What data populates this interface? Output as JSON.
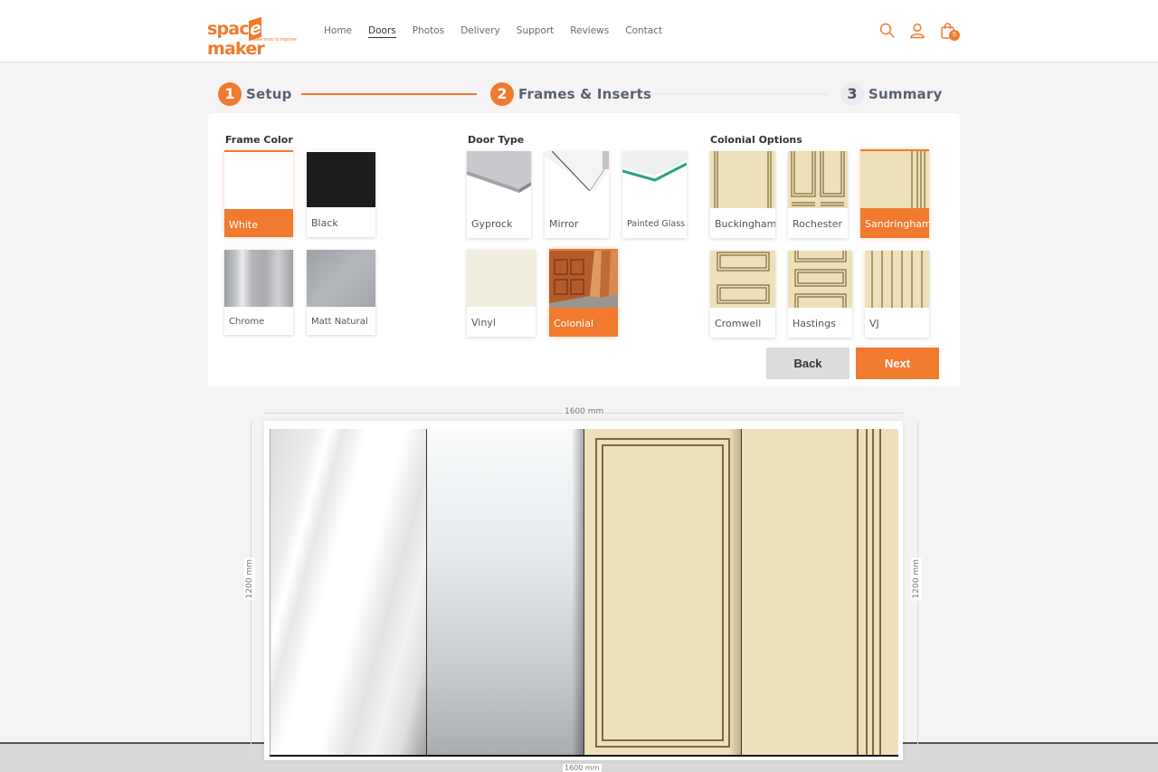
{
  "brand": {
    "name_prefix": "spac",
    "name_e": "e",
    "name_suffix": "maker",
    "tagline": "Make room to improve",
    "accent": "#f07a2e"
  },
  "nav": {
    "items": [
      {
        "label": "Home",
        "active": false
      },
      {
        "label": "Doors",
        "active": true
      },
      {
        "label": "Photos",
        "active": false
      },
      {
        "label": "Delivery",
        "active": false
      },
      {
        "label": "Support",
        "active": false
      },
      {
        "label": "Reviews",
        "active": false
      },
      {
        "label": "Contact",
        "active": false
      }
    ],
    "icons": [
      "search-icon",
      "account-icon",
      "cart-icon"
    ],
    "cart_count": "5"
  },
  "stepper": {
    "steps": [
      {
        "num": "1",
        "label": "Setup",
        "state": "done"
      },
      {
        "num": "2",
        "label": "Frames & Inserts",
        "state": "current"
      },
      {
        "num": "3",
        "label": "Summary",
        "state": "upcoming"
      }
    ]
  },
  "frame_color": {
    "title": "Frame Color",
    "options": [
      {
        "label": "White",
        "selected": true
      },
      {
        "label": "Black",
        "selected": false
      },
      {
        "label": "Chrome",
        "selected": false
      },
      {
        "label": "Matt Natural",
        "selected": false
      }
    ]
  },
  "door_type": {
    "title": "Door Type",
    "options": [
      {
        "label": "Gyprock",
        "selected": false
      },
      {
        "label": "Mirror",
        "selected": false
      },
      {
        "label": "Painted Glass",
        "selected": false
      },
      {
        "label": "Vinyl",
        "selected": false
      },
      {
        "label": "Colonial",
        "selected": true
      }
    ]
  },
  "colonial_options": {
    "title": "Colonial Options",
    "options": [
      {
        "label": "Buckingham",
        "selected": false
      },
      {
        "label": "Rochester",
        "selected": false
      },
      {
        "label": "Sandringham",
        "selected": true
      },
      {
        "label": "Cromwell",
        "selected": false
      },
      {
        "label": "Hastings",
        "selected": false
      },
      {
        "label": "VJ",
        "selected": false
      }
    ]
  },
  "actions": {
    "back_label": "Back",
    "next_label": "Next"
  },
  "preview": {
    "width_label": "1600 mm",
    "height_label": "1200 mm",
    "doors": [
      "Mirror",
      "Mirror",
      "Colonial - Cromwell style",
      "Colonial - Sandringham"
    ]
  }
}
